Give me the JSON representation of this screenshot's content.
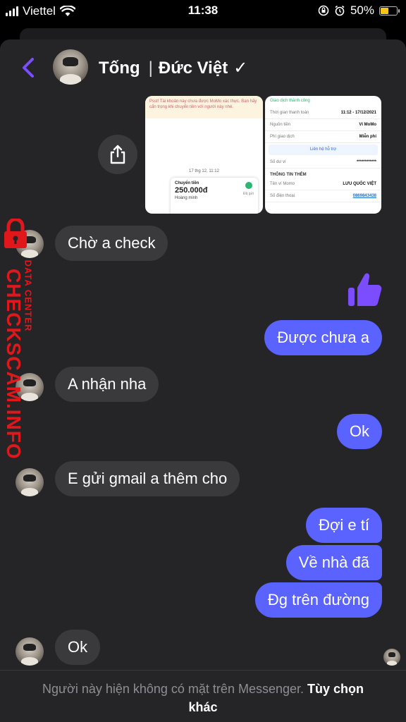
{
  "status_bar": {
    "carrier": "Viettel",
    "time": "11:38",
    "battery": "50%",
    "battery_level": 0.5
  },
  "header": {
    "first_name": "Tống",
    "separator": "|",
    "full_name": "Đức Việt",
    "verified_mark": "✓"
  },
  "attachments": {
    "left": {
      "warning": "Psst! Tài khoản này chưa được MoMo xác thực. Bạn hãy cẩn trọng khi chuyển tiền với người này nhé.",
      "date": "17 thg 12, 11:12",
      "transfer_label": "Chuyển tiền",
      "amount": "250.000đ",
      "status": "Đã gửi",
      "sender": "Hoàng minh"
    },
    "right": {
      "success": "Giao dịch thành công",
      "rows": [
        {
          "k": "Thời gian thanh toán",
          "v": "11:12 - 17/12/2021"
        },
        {
          "k": "Nguồn tiền",
          "v": "Ví MoMo"
        },
        {
          "k": "Phí giao dịch",
          "v": "Miễn phí"
        }
      ],
      "support": "Liên hệ hỗ trợ",
      "balance_label": "Số dư ví",
      "balance_value": "************",
      "more_title": "THÔNG TIN THÊM",
      "wallet_name_label": "Tên ví Momo",
      "wallet_name": "LƯU QUỐC VIỆT",
      "phone_label": "Số điện thoại",
      "phone": "0869843438"
    }
  },
  "messages": [
    {
      "side": "in",
      "text": "Chờ a check"
    },
    {
      "side": "out",
      "text": "Được chưa a"
    },
    {
      "side": "in",
      "text": "A nhận nha"
    },
    {
      "side": "out",
      "text": "Ok"
    },
    {
      "side": "in",
      "text": "E gửi gmail a thêm cho"
    },
    {
      "side": "out",
      "text": "Đợi e tí"
    },
    {
      "side": "out",
      "text": "Về nhà đã"
    },
    {
      "side": "out",
      "text": "Đg trên đường"
    },
    {
      "side": "in",
      "text": "Ok"
    }
  ],
  "watermark": {
    "brand": "CHECKSCAM.INFO",
    "sub": "DATA CENTER"
  },
  "footer": {
    "notice": "Người này hiện không có mặt trên Messenger.",
    "action": "Tùy chọn khác"
  },
  "colors": {
    "accent": "#7b4dff",
    "outgoing_bubble": "#5a62ff",
    "incoming_bubble": "#3a3a3c",
    "watermark_red": "#e0181c"
  }
}
